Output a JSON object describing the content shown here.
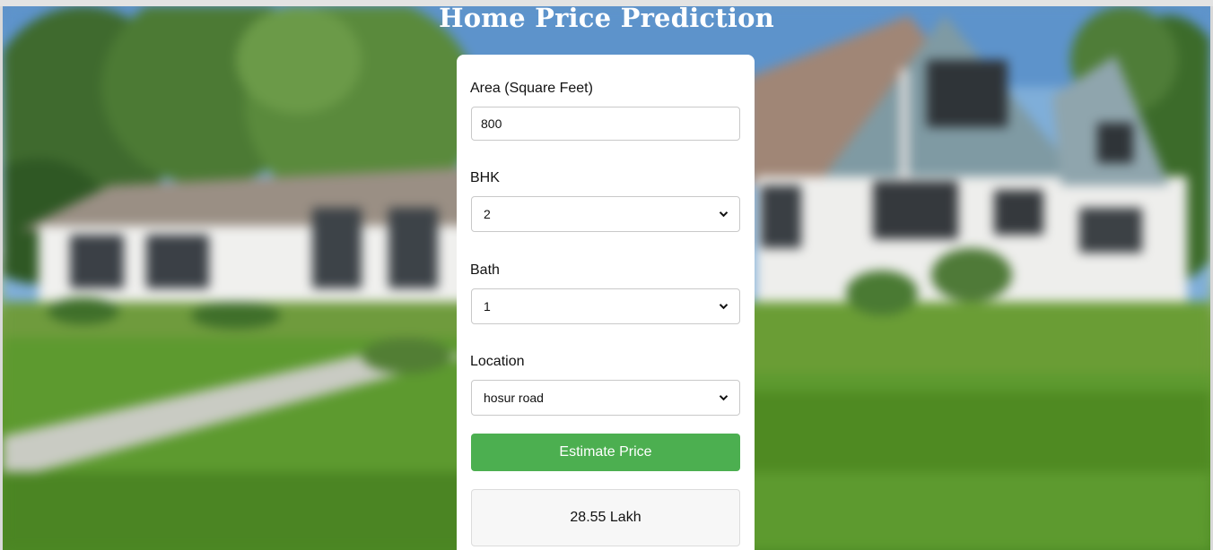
{
  "page": {
    "title": "Home Price Prediction"
  },
  "form": {
    "area": {
      "label": "Area (Square Feet)",
      "value": "800"
    },
    "bhk": {
      "label": "BHK",
      "selected": "2"
    },
    "bath": {
      "label": "Bath",
      "selected": "1"
    },
    "location": {
      "label": "Location",
      "selected": "hosur road"
    },
    "submit_label": "Estimate Price"
  },
  "result": {
    "text": "28.55 Lakh"
  },
  "colors": {
    "button": "#4caf50",
    "card": "#ffffff",
    "title": "#ffffff"
  }
}
